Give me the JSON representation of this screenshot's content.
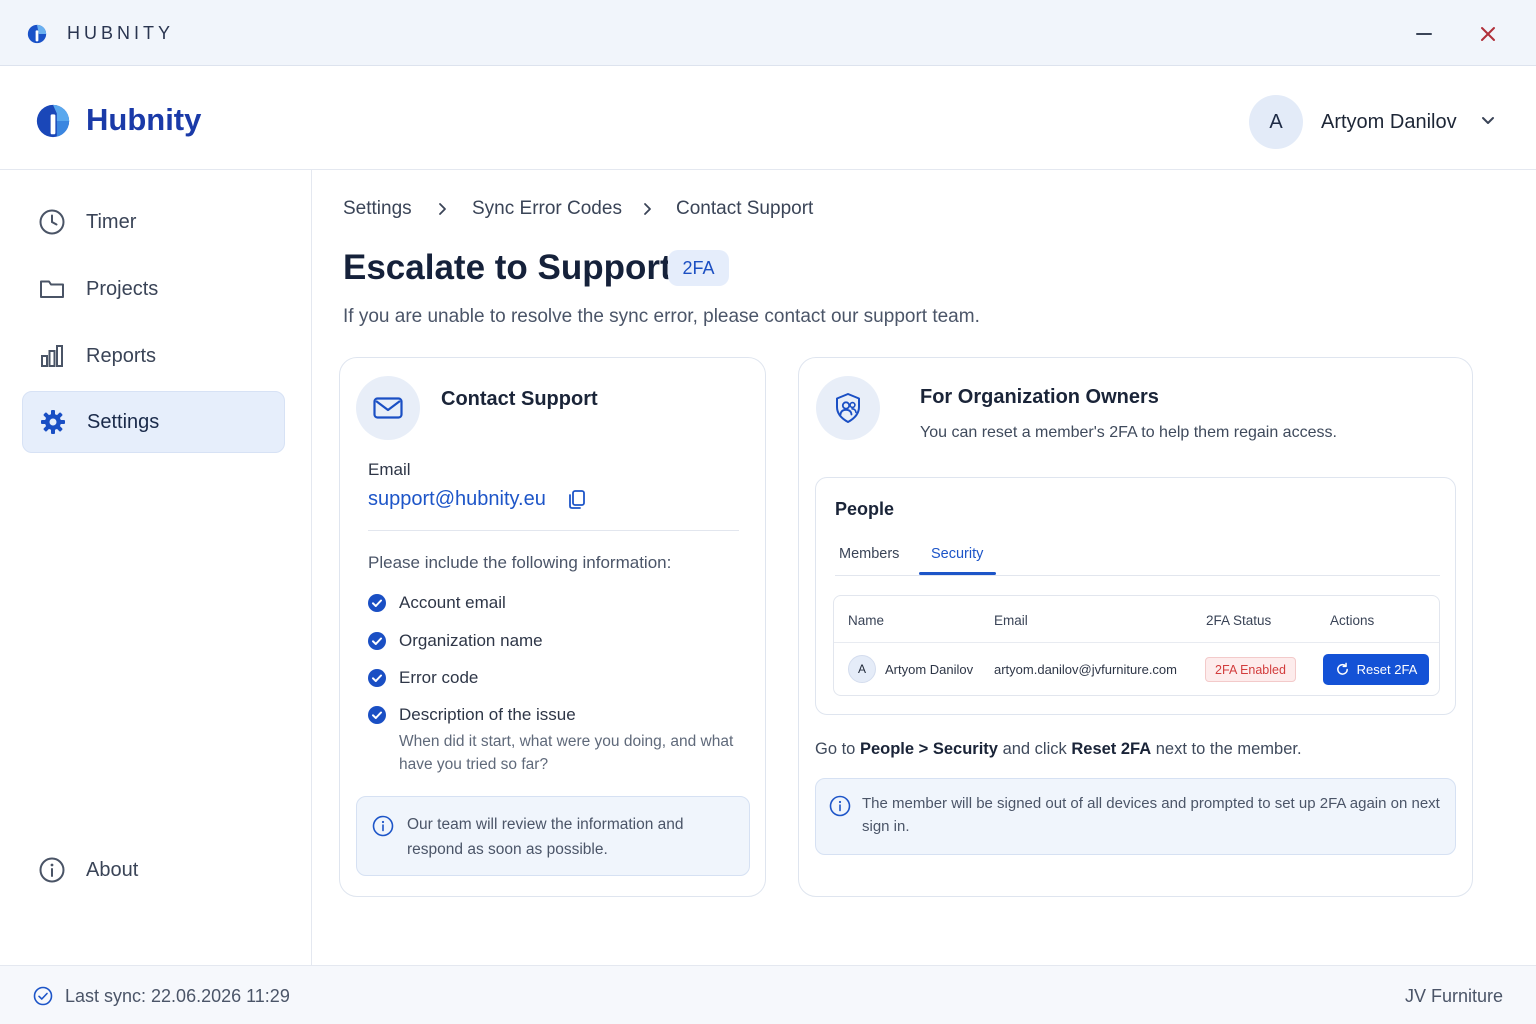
{
  "window": {
    "title": "HUBNITY",
    "minimize_icon": "minimize-icon",
    "close_icon": "close-icon"
  },
  "header": {
    "brand": "Hubnity",
    "user": {
      "initial": "A",
      "name": "Artyom Danilov"
    }
  },
  "sidebar": {
    "items": [
      {
        "label": "Timer",
        "icon": "clock-icon",
        "active": false
      },
      {
        "label": "Projects",
        "icon": "folder-icon",
        "active": false
      },
      {
        "label": "Reports",
        "icon": "bar-chart-icon",
        "active": false
      },
      {
        "label": "Settings",
        "icon": "gear-icon",
        "active": true
      }
    ],
    "about": {
      "label": "About",
      "icon": "info-icon"
    }
  },
  "breadcrumb": [
    "Settings",
    "Sync Error Codes",
    "Contact Support"
  ],
  "page": {
    "title": "Escalate to Support",
    "badge": "2FA",
    "subtitle": "If you are unable to resolve the sync error, please contact our support team."
  },
  "contact_card": {
    "title": "Contact Support",
    "email_label": "Email",
    "email": "support@hubnity.eu",
    "include_heading": "Please include the following information:",
    "checklist": [
      "Account email",
      "Organization name",
      "Error code",
      "Description of the issue"
    ],
    "hint": "When did it start, what were you doing, and what have you tried so far?",
    "info": "Our team will review the information and respond as soon as possible."
  },
  "owners_card": {
    "title": "For Organization Owners",
    "subtitle": "You can reset a member's 2FA to help them regain access.",
    "people": {
      "title": "People",
      "tabs": [
        "Members",
        "Security"
      ],
      "active_tab": "Security",
      "columns": [
        "Name",
        "Email",
        "2FA Status",
        "Actions"
      ],
      "row": {
        "initial": "A",
        "name": "Artyom Danilov",
        "email": "artyom.danilov@jvfurniture.com",
        "status": "2FA Enabled",
        "action": "Reset 2FA"
      }
    },
    "instruction": {
      "part1": "Go to ",
      "path": "People > Security",
      "part2": " and click ",
      "action": "Reset 2FA",
      "part3": " next to the member."
    },
    "info": "The member will be signed out of all devices and prompted to set up 2FA again on next sign in."
  },
  "statusbar": {
    "last_sync": "Last sync: 22.06.2026 11:29",
    "organization": "JV Furniture"
  },
  "colors": {
    "accent": "#1452d6",
    "brand": "#1a3aa8",
    "link": "#1d55c8",
    "danger": "#d23c3c",
    "active_nav_bg": "#e6eefb"
  }
}
